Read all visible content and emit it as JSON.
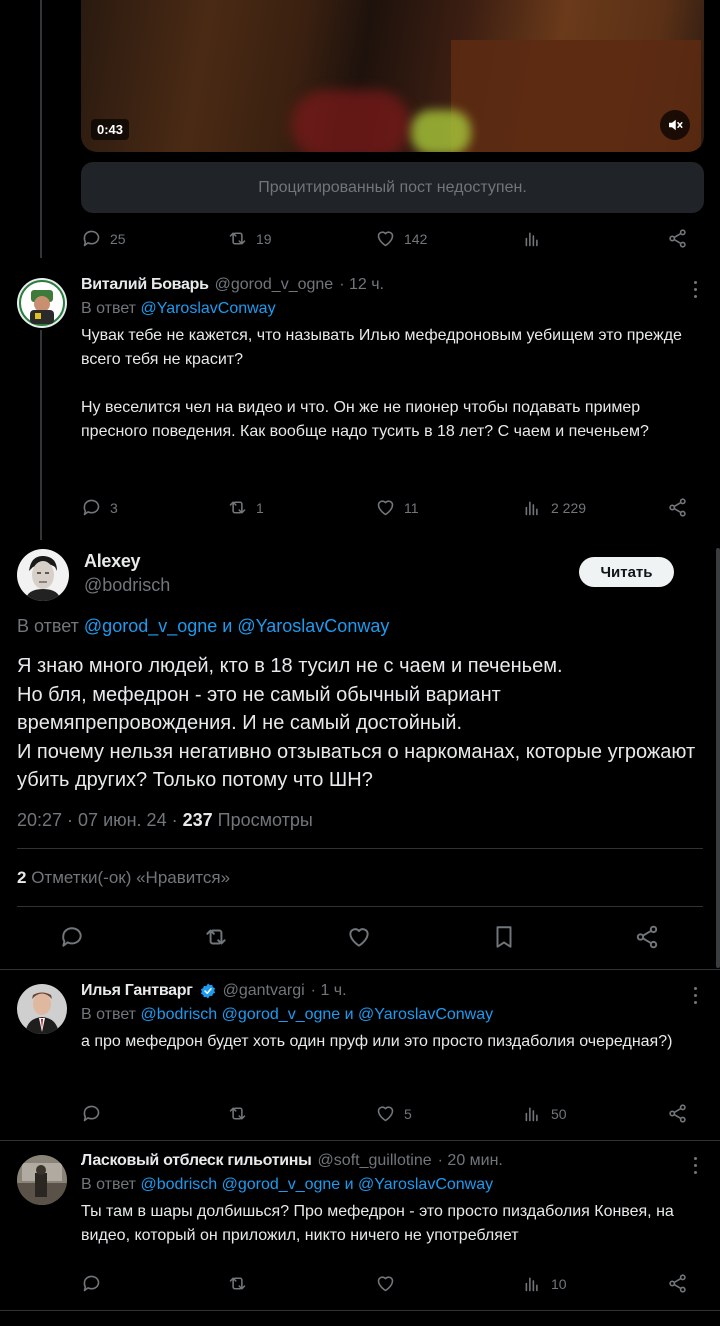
{
  "video": {
    "time": "0:43"
  },
  "quoted_unavailable": "Процитированный пост недоступен.",
  "top_actions": {
    "replies": "25",
    "reposts": "19",
    "likes": "142"
  },
  "reply1": {
    "name": "Виталий Боварь",
    "handle": "@gorod_v_ogne",
    "time": "· 12 ч.",
    "replying_prefix": "В ответ",
    "replying_to": "@YaroslavConway",
    "text": "Чувак тебе не кажется, что называть Илью мефедроновым уебищем это прежде всего тебя не красит?\n\nНу веселится чел на видео и что. Он же не пионер чтобы подавать пример пресного поведения. Как вообще надо тусить в 18 лет? С чаем и печеньем?",
    "replies": "3",
    "reposts": "1",
    "likes": "11",
    "views": "2 229"
  },
  "main": {
    "name": "Alexey",
    "handle": "@bodrisch",
    "follow": "Читать",
    "replying_prefix": "В ответ",
    "replying_to": "@gorod_v_ogne и @YaroslavConway",
    "text": "Я знаю много людей, кто в 18 тусил не с чаем и печеньем.\nНо бля, мефедрон - это не самый обычный вариант времяпрепровождения. И не самый достойный.\nИ почему нельзя негативно отзываться о наркоманах, которые угрожают убить других? Только потому что ШН?",
    "datetime": "20:27 · 07 июн. 24 · ",
    "views": "237",
    "views_label": " Просмотры",
    "likes_count": "2",
    "likes_label": " Отметки(-ок) «Нравится»"
  },
  "reply2": {
    "name": "Илья Гантварг",
    "handle": "@gantvargi",
    "time": "· 1 ч.",
    "replying_prefix": "В ответ",
    "replying_to": "@bodrisch @gorod_v_ogne и @YaroslavConway",
    "text": "а про мефедрон будет хоть один пруф или это просто пиздаболия очередная?)",
    "likes": "5",
    "views": "50"
  },
  "reply3": {
    "name": "Ласковый отблеск гильотины",
    "handle": "@soft_guillotine",
    "time": "· 20 мин.",
    "replying_prefix": "В ответ",
    "replying_to": "@bodrisch @gorod_v_ogne и @YaroslavConway",
    "text": "Ты там в шары долбишься? Про мефедрон - это просто пиздаболия Конвея, на видео, который он приложил, никто ничего не употребляет",
    "views": "10"
  },
  "colors": {
    "link": "#1d9bf0",
    "muted": "#71767b",
    "background": "#000000",
    "verified": "#1d9bf0"
  }
}
